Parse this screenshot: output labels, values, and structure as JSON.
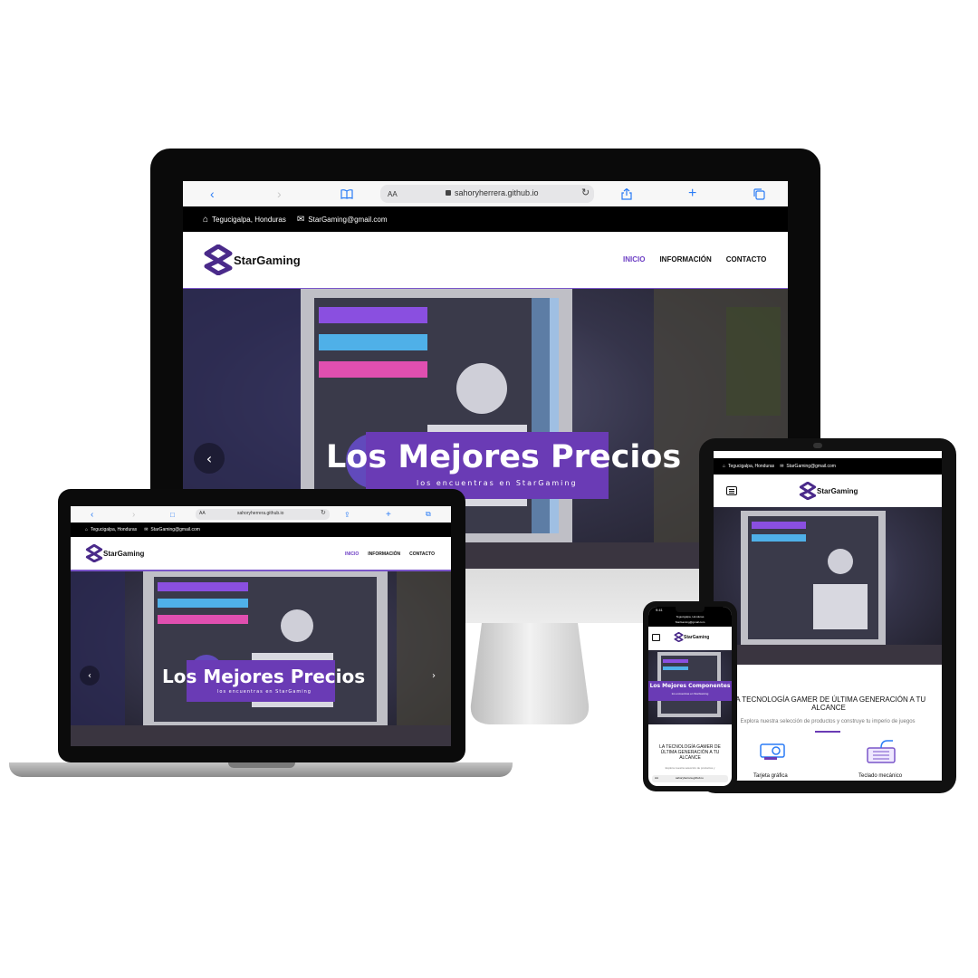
{
  "site": {
    "url": "sahoryherrera.github.io",
    "url_small": "sahoryherrera.github.io",
    "url_phone": "sahoryherrera.github.io",
    "aa": "AA",
    "location": "Tegucigalpa, Honduras",
    "email": "StarGaming@gmail.com",
    "brand": "StarGaming",
    "nav": [
      "INICIO",
      "INFORMACIÓN",
      "CONTACTO"
    ],
    "hero_title": "Los Mejores Precios",
    "hero_subtitle": "los encuentras en StarGaming",
    "phone_hero_title": "Los Mejores Componentes",
    "phone_hero_subtitle": "los encuentras en StarGaming",
    "section_title": "LA TECNOLOGÍA GAMER DE ÚLTIMA GENERACIÓN A TU ALCANCE",
    "section_title_phone": "LA TECNOLOGÍA GAMER DE ÚLTIMA GENERACIÓN A TU ALCANCE",
    "section_text": "Explora nuestra selección de productos y construye tu imperio de juegos",
    "section_text_phone": "Explora nuestra selección de productos y",
    "products": [
      "Tarjeta gráfica",
      "Teclado mecánico"
    ],
    "phone_time": "9:41",
    "phone_location": "Tegucigalpa, Honduras",
    "phone_email": "StarGaming@gmail.com"
  },
  "colors": {
    "accent": "#6a3bb5",
    "active_nav": "#6d3fc4",
    "link_blue": "#2a7cf6"
  },
  "icons": [
    "back-icon",
    "forward-icon",
    "book-icon",
    "lock-icon",
    "reload-icon",
    "share-icon",
    "plus-icon",
    "tabs-icon",
    "home-icon",
    "mail-icon",
    "menu-icon",
    "graphics-card-icon",
    "keyboard-icon"
  ]
}
